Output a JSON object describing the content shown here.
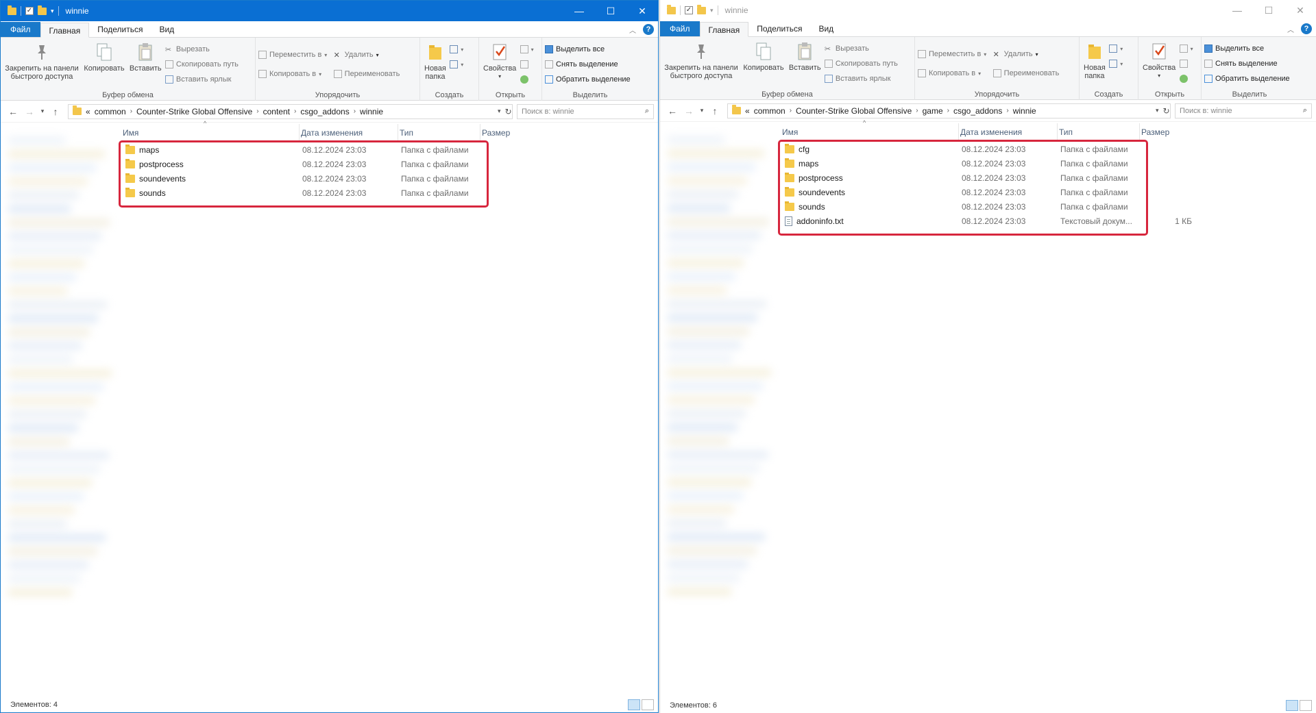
{
  "windows": [
    {
      "title": "winnie",
      "tabs": {
        "file": "Файл",
        "home": "Главная",
        "share": "Поделиться",
        "view": "Вид"
      },
      "ribbon": {
        "pin_label_1": "Закрепить на панели",
        "pin_label_2": "быстрого доступа",
        "copy": "Копировать",
        "paste": "Вставить",
        "cut": "Вырезать",
        "copy_path": "Скопировать путь",
        "paste_shortcut": "Вставить ярлык",
        "clipboard_group": "Буфер обмена",
        "move_to": "Переместить в",
        "copy_to": "Копировать в",
        "delete": "Удалить",
        "rename": "Переименовать",
        "organize_group": "Упорядочить",
        "new_folder_1": "Новая",
        "new_folder_2": "папка",
        "create_group": "Создать",
        "properties": "Свойства",
        "open_group": "Открыть",
        "select_all": "Выделить все",
        "select_none": "Снять выделение",
        "invert": "Обратить выделение",
        "select_group": "Выделить"
      },
      "breadcrumb": [
        "«",
        "common",
        "Counter-Strike Global Offensive",
        "content",
        "csgo_addons",
        "winnie"
      ],
      "search_placeholder": "Поиск в: winnie",
      "columns": {
        "name": "Имя",
        "date": "Дата изменения",
        "type": "Тип",
        "size": "Размер"
      },
      "files": [
        {
          "name": "maps",
          "date": "08.12.2024 23:03",
          "type": "Папка с файлами",
          "size": "",
          "kind": "folder"
        },
        {
          "name": "postprocess",
          "date": "08.12.2024 23:03",
          "type": "Папка с файлами",
          "size": "",
          "kind": "folder"
        },
        {
          "name": "soundevents",
          "date": "08.12.2024 23:03",
          "type": "Папка с файлами",
          "size": "",
          "kind": "folder"
        },
        {
          "name": "sounds",
          "date": "08.12.2024 23:03",
          "type": "Папка с файлами",
          "size": "",
          "kind": "folder"
        }
      ],
      "status": "Элементов: 4"
    },
    {
      "title": "winnie",
      "tabs": {
        "file": "Файл",
        "home": "Главная",
        "share": "Поделиться",
        "view": "Вид"
      },
      "ribbon": {
        "pin_label_1": "Закрепить на панели",
        "pin_label_2": "быстрого доступа",
        "copy": "Копировать",
        "paste": "Вставить",
        "cut": "Вырезать",
        "copy_path": "Скопировать путь",
        "paste_shortcut": "Вставить ярлык",
        "clipboard_group": "Буфер обмена",
        "move_to": "Переместить в",
        "copy_to": "Копировать в",
        "delete": "Удалить",
        "rename": "Переименовать",
        "organize_group": "Упорядочить",
        "new_folder_1": "Новая",
        "new_folder_2": "папка",
        "create_group": "Создать",
        "properties": "Свойства",
        "open_group": "Открыть",
        "select_all": "Выделить все",
        "select_none": "Снять выделение",
        "invert": "Обратить выделение",
        "select_group": "Выделить"
      },
      "breadcrumb": [
        "«",
        "common",
        "Counter-Strike Global Offensive",
        "game",
        "csgo_addons",
        "winnie"
      ],
      "search_placeholder": "Поиск в: winnie",
      "columns": {
        "name": "Имя",
        "date": "Дата изменения",
        "type": "Тип",
        "size": "Размер"
      },
      "files": [
        {
          "name": "cfg",
          "date": "08.12.2024 23:03",
          "type": "Папка с файлами",
          "size": "",
          "kind": "folder"
        },
        {
          "name": "maps",
          "date": "08.12.2024 23:03",
          "type": "Папка с файлами",
          "size": "",
          "kind": "folder"
        },
        {
          "name": "postprocess",
          "date": "08.12.2024 23:03",
          "type": "Папка с файлами",
          "size": "",
          "kind": "folder"
        },
        {
          "name": "soundevents",
          "date": "08.12.2024 23:03",
          "type": "Папка с файлами",
          "size": "",
          "kind": "folder"
        },
        {
          "name": "sounds",
          "date": "08.12.2024 23:03",
          "type": "Папка с файлами",
          "size": "",
          "kind": "folder"
        },
        {
          "name": "addoninfo.txt",
          "date": "08.12.2024 23:03",
          "type": "Текстовый докум...",
          "size": "1 КБ",
          "kind": "text"
        }
      ],
      "status": "Элементов: 6"
    }
  ],
  "colors": {
    "accent": "#1979ca",
    "highlight_border": "#d7263d",
    "folder": "#f5c94a"
  }
}
